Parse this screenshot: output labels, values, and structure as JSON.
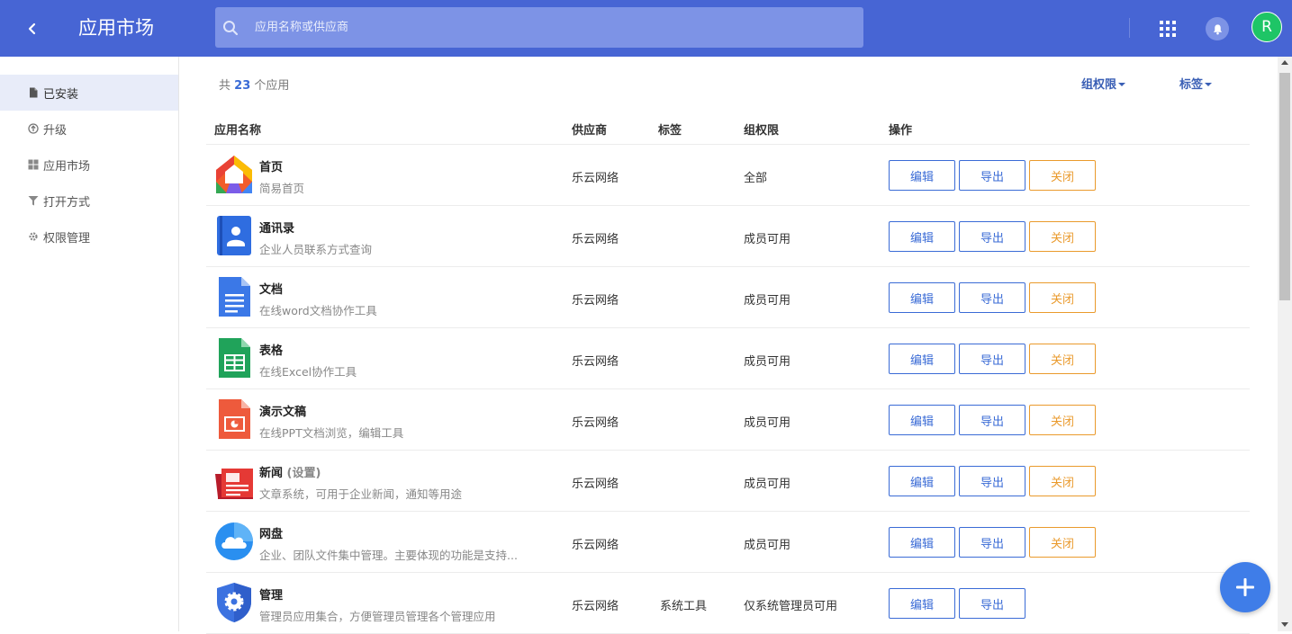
{
  "header": {
    "title": "应用市场",
    "search_placeholder": "应用名称或供应商",
    "avatar_letter": "R",
    "bg_color": "#4765d4"
  },
  "sidebar": {
    "items": [
      {
        "label": "已安装",
        "icon": "file-icon",
        "active": true
      },
      {
        "label": "升级",
        "icon": "upgrade-icon"
      },
      {
        "label": "应用市场",
        "icon": "grid-icon"
      },
      {
        "label": "打开方式",
        "icon": "filter-icon"
      },
      {
        "label": "权限管理",
        "icon": "gear-icon"
      }
    ]
  },
  "summary": {
    "prefix": "共",
    "count": "23",
    "suffix": "个应用"
  },
  "filters": {
    "permission": "组权限",
    "tags": "标签"
  },
  "table": {
    "headers": {
      "name": "应用名称",
      "vendor": "供应商",
      "tag": "标签",
      "permission": "组权限",
      "actions": "操作"
    },
    "buttons": {
      "edit": "编辑",
      "export": "导出",
      "close": "关闭"
    },
    "rows": [
      {
        "name": "首页",
        "desc": "简易首页",
        "vendor": "乐云网络",
        "tag": "",
        "permission": "全部",
        "icon": "home-app-icon",
        "closable": true
      },
      {
        "name": "通讯录",
        "desc": "企业人员联系方式查询",
        "vendor": "乐云网络",
        "tag": "",
        "permission": "成员可用",
        "icon": "contacts-app-icon",
        "closable": true
      },
      {
        "name": "文档",
        "desc": "在线word文档协作工具",
        "vendor": "乐云网络",
        "tag": "",
        "permission": "成员可用",
        "icon": "docs-app-icon",
        "closable": true
      },
      {
        "name": "表格",
        "desc": "在线Excel协作工具",
        "vendor": "乐云网络",
        "tag": "",
        "permission": "成员可用",
        "icon": "sheets-app-icon",
        "closable": true
      },
      {
        "name": "演示文稿",
        "desc": "在线PPT文档浏览，编辑工具",
        "vendor": "乐云网络",
        "tag": "",
        "permission": "成员可用",
        "icon": "slides-app-icon",
        "closable": true
      },
      {
        "name": "新闻",
        "name_extra": "(设置)",
        "desc": "文章系统，可用于企业新闻，通知等用途",
        "vendor": "乐云网络",
        "tag": "",
        "permission": "成员可用",
        "icon": "news-app-icon",
        "closable": true
      },
      {
        "name": "网盘",
        "desc": "企业、团队文件集中管理。主要体现的功能是支持...",
        "vendor": "乐云网络",
        "tag": "",
        "permission": "成员可用",
        "icon": "cloud-drive-app-icon",
        "closable": true
      },
      {
        "name": "管理",
        "desc": "管理员应用集合，方便管理员管理各个管理应用",
        "vendor": "乐云网络",
        "tag": "系统工具",
        "permission": "仅系统管理员可用",
        "icon": "admin-app-icon",
        "closable": false
      }
    ]
  },
  "colors": {
    "accent": "#3a6bd6",
    "close": "#ea9a2c",
    "fab": "#3f7de8"
  }
}
